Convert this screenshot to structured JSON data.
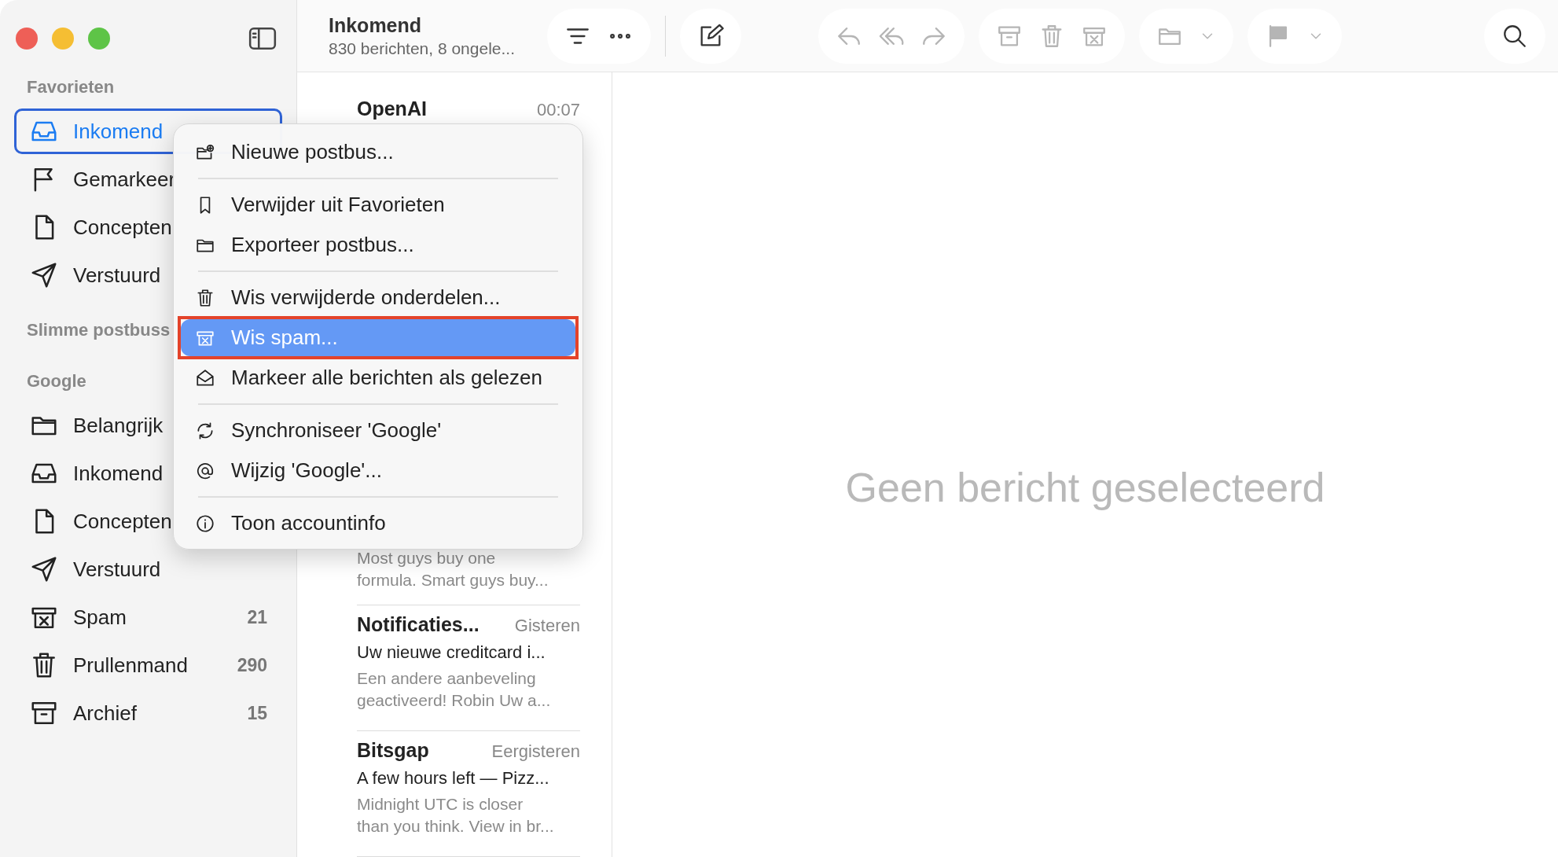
{
  "toolbar": {
    "title": "Inkomend",
    "subtitle": "830 berichten, 8 ongele..."
  },
  "sidebar": {
    "sections": [
      {
        "title": "Favorieten",
        "items": [
          {
            "label": "Inkomend",
            "selected": true
          },
          {
            "label": "Gemarkeer",
            "selected": false
          },
          {
            "label": "Concepten",
            "selected": false
          },
          {
            "label": "Verstuurd",
            "selected": false
          }
        ]
      },
      {
        "title": "Slimme postbuss"
      },
      {
        "title": "Google",
        "items": [
          {
            "label": "Belangrijk",
            "selected": false
          },
          {
            "label": "Inkomend",
            "selected": false
          },
          {
            "label": "Concepten",
            "selected": false
          },
          {
            "label": "Verstuurd",
            "selected": false
          },
          {
            "label": "Spam",
            "count": "21",
            "selected": false
          },
          {
            "label": "Prullenmand",
            "count": "290",
            "selected": false
          },
          {
            "label": "Archief",
            "count": "15",
            "selected": false
          }
        ]
      }
    ]
  },
  "messages": [
    {
      "kind": "full",
      "sender": "OpenAI",
      "time": "00:07"
    },
    {
      "kind": "preview_only",
      "preview": "Most guys buy one formula. Smart guys buy..."
    },
    {
      "kind": "full",
      "sender": "Notificaties...",
      "time": "Gisteren",
      "subject": "Uw nieuwe creditcard i...",
      "preview": "Een andere aanbeveling geactiveerd! Robin Uw a..."
    },
    {
      "kind": "full",
      "sender": "Bitsgap",
      "time": "Eergisteren",
      "subject": "A few hours left — Pizz...",
      "preview": "Midnight UTC is closer than you think. View in br..."
    }
  ],
  "empty_state": "Geen bericht geselecteerd",
  "context_menu": [
    {
      "kind": "item",
      "label": "Nieuwe postbus...",
      "selected": false
    },
    {
      "kind": "separator"
    },
    {
      "kind": "item",
      "label": "Verwijder uit Favorieten",
      "selected": false
    },
    {
      "kind": "item",
      "label": "Exporteer postbus...",
      "selected": false
    },
    {
      "kind": "separator"
    },
    {
      "kind": "item",
      "label": "Wis verwijderde onderdelen...",
      "selected": false
    },
    {
      "kind": "item",
      "label": "Wis spam...",
      "selected": true,
      "annotated": true
    },
    {
      "kind": "item",
      "label": "Markeer alle berichten als gelezen",
      "selected": false
    },
    {
      "kind": "separator"
    },
    {
      "kind": "item",
      "label": "Synchroniseer 'Google'",
      "selected": false
    },
    {
      "kind": "item",
      "label": "Wijzig 'Google'...",
      "selected": false
    },
    {
      "kind": "separator"
    },
    {
      "kind": "item",
      "label": "Toon accountinfo",
      "selected": false
    }
  ]
}
